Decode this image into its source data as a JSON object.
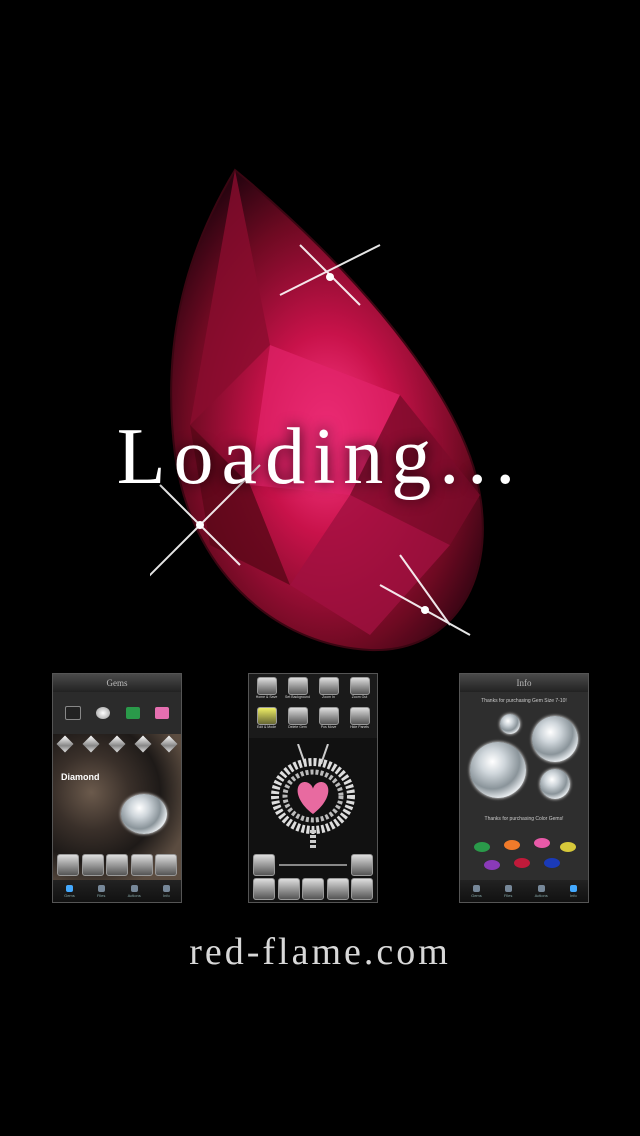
{
  "loading_text": "Loading...",
  "site_url": "red-flame.com",
  "colors": {
    "background": "#000000",
    "ruby": "#b0103a",
    "ruby_highlight": "#ff3d8a"
  },
  "screenshots": [
    {
      "title": "Gems",
      "gem_labels": [
        "Non Diamond",
        "Diamond",
        "Emerald",
        "Pink Sapphire"
      ],
      "heading": "Diamond",
      "tabs": [
        "Gems",
        "Files",
        "Actions",
        "Info"
      ]
    },
    {
      "tools": [
        "Home & Save",
        "Set Background",
        "Zoom In",
        "Zoom Out",
        "Edit & Mode",
        "Delete Gem",
        "Pos Move",
        "Hide Panels"
      ]
    },
    {
      "title": "Info",
      "line1": "Thanks for purchasing Gem Size 7-10!",
      "line2": "Thanks for purchasing Color Gems!",
      "tabs": [
        "Gems",
        "Files",
        "Actions",
        "Info"
      ]
    }
  ]
}
